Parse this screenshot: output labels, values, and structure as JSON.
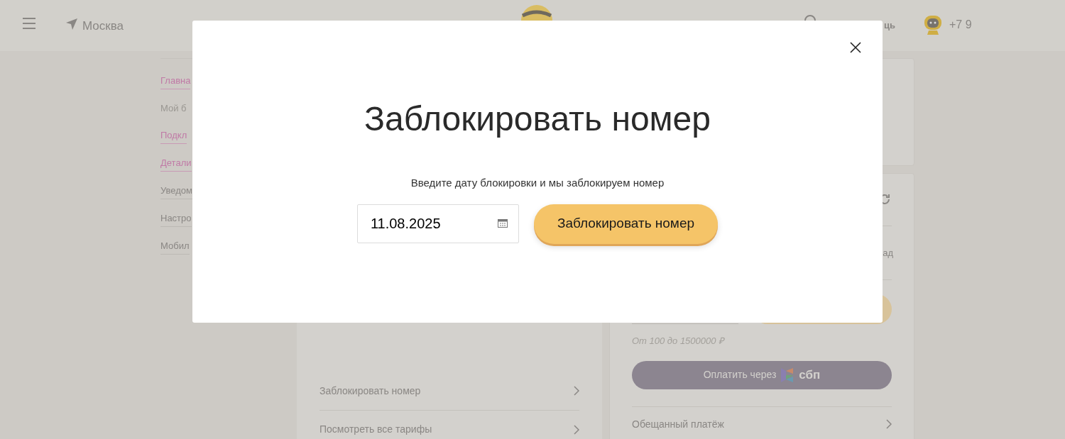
{
  "header": {
    "city": "Москва",
    "help_partial": "ць",
    "phone_partial": "+7 9"
  },
  "sidebar": {
    "items": [
      {
        "label": "Главна",
        "kind": "accent"
      },
      {
        "label": "Мой б",
        "kind": "muted"
      },
      {
        "label": "Подкл",
        "kind": "accent"
      },
      {
        "label": "Детали",
        "kind": "accent"
      },
      {
        "label": "Уведом",
        "kind": "plain"
      },
      {
        "label": "Настро",
        "kind": "plain"
      },
      {
        "label": "Мобил",
        "kind": "plain"
      }
    ]
  },
  "actions_card": {
    "items": [
      "Заблокировать номер",
      "Посмотреть все тарифы"
    ]
  },
  "payment_card": {
    "partial_text": "ад",
    "limit_hint": "От 100 до 1500000 ₽",
    "sbp_button": {
      "label": "Оплатить через",
      "logo_text": "сбп"
    },
    "promised_payment": "Обещанный платёж"
  },
  "modal": {
    "title": "Заблокировать номер",
    "text": "Введите дату блокировки и мы заблокируем номер",
    "date_field": {
      "value": "11.08.2025"
    },
    "submit_button": "Заблокировать номер"
  }
}
